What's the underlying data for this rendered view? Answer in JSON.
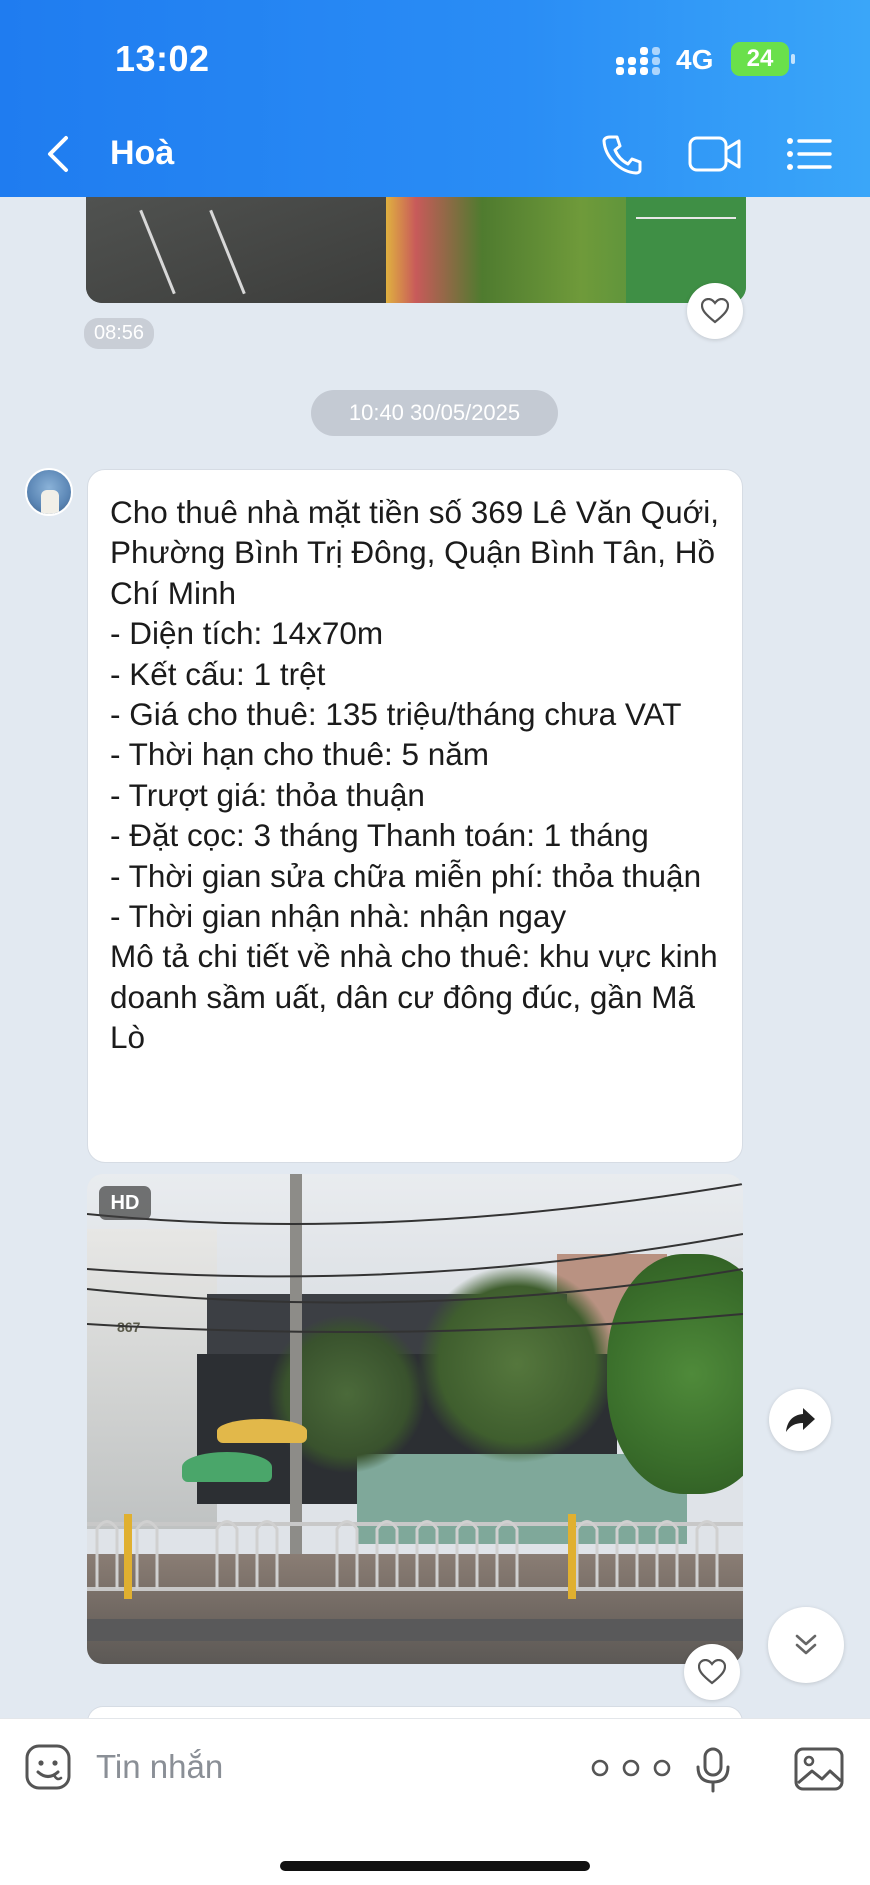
{
  "status_bar": {
    "time": "13:02",
    "network": "4G",
    "battery": "24"
  },
  "header": {
    "title": "Hoà"
  },
  "chat": {
    "first_image_time": "08:56",
    "date_separator": "10:40 30/05/2025",
    "message_text": "Cho thuê nhà mặt tiền số 369 Lê Văn Quới, Phường Bình Trị Đông, Quận Bình Tân, Hồ Chí Minh\n- Diện tích: 14x70m\n- Kết cấu: 1 trệt\n- Giá cho thuê: 135 triệu/tháng chưa VAT\n- Thời hạn cho thuê: 5 năm\n- Trượt giá: thỏa thuận\n- Đặt cọc: 3 tháng Thanh toán: 1 tháng\n- Thời gian sửa chữa miễn phí: thỏa thuận\n- Thời gian nhận nhà: nhận ngay\nMô tả chi tiết về nhà cho thuê: khu vực kinh doanh sầm uất, dân cư đông đúc, gần Mã Lò",
    "photo_badge": "HD",
    "photo_sign": "867"
  },
  "input": {
    "placeholder": "Tin nhắn"
  },
  "icons": {
    "back": "chevron-left-icon",
    "phone": "phone-icon",
    "video": "video-icon",
    "menu": "list-menu-icon",
    "sticker": "sticker-icon",
    "more": "more-dots-icon",
    "mic": "mic-icon",
    "image": "image-icon",
    "heart": "heart-icon",
    "share": "share-icon",
    "scroll": "double-chevron-down-icon"
  },
  "colors": {
    "header_start": "#1f7cf0",
    "header_end": "#3aa6f9",
    "chat_bg": "#e2e9f1",
    "battery": "#6ae04b"
  }
}
